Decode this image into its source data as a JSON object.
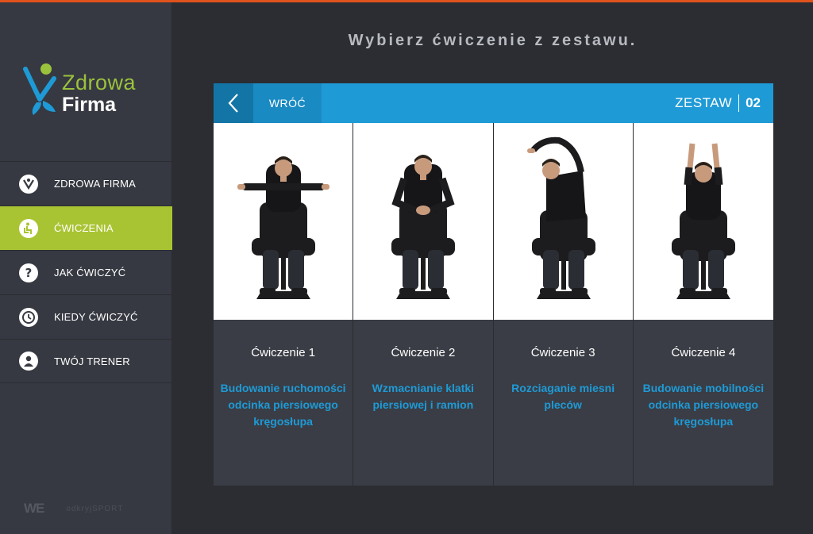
{
  "brand": {
    "line1": "Zdrowa",
    "line2": "Firma"
  },
  "sidebar": {
    "items": [
      {
        "label": "ZDROWA FIRMA",
        "icon": "figure-icon",
        "active": false
      },
      {
        "label": "ĆWICZENIA",
        "icon": "seated-exercise-icon",
        "active": true
      },
      {
        "label": "JAK ĆWICZYĆ",
        "icon": "question-icon",
        "active": false
      },
      {
        "label": "KIEDY ĆWICZYĆ",
        "icon": "clock-icon",
        "active": false
      },
      {
        "label": "TWÓJ TRENER",
        "icon": "user-icon",
        "active": false
      }
    ],
    "footer": {
      "logo1": "WE",
      "logo2": "odkryjSPORT"
    }
  },
  "main": {
    "headline": "Wybierz ćwiczenie z zestawu.",
    "back_label": "WRÓĆ",
    "set_label": "ZESTAW",
    "set_number": "02",
    "exercises": [
      {
        "name": "Ćwiczenie 1",
        "description": "Budowanie ruchomości odcinka piersiowego kręgosłupa",
        "pose": "arms-horizontal"
      },
      {
        "name": "Ćwiczenie 2",
        "description": "Wzmacnianie klatki piersiowej i ramion",
        "pose": "hands-clasped"
      },
      {
        "name": "Ćwiczenie 3",
        "description": "Rozciaganie miesni pleców",
        "pose": "side-stretch"
      },
      {
        "name": "Ćwiczenie 4",
        "description": "Budowanie mobilności odcinka piersiowego kręgosłupa",
        "pose": "arms-up"
      }
    ]
  },
  "colors": {
    "accent_green": "#a9c433",
    "accent_blue": "#1e9ad6",
    "top_line": "#e0531c"
  }
}
